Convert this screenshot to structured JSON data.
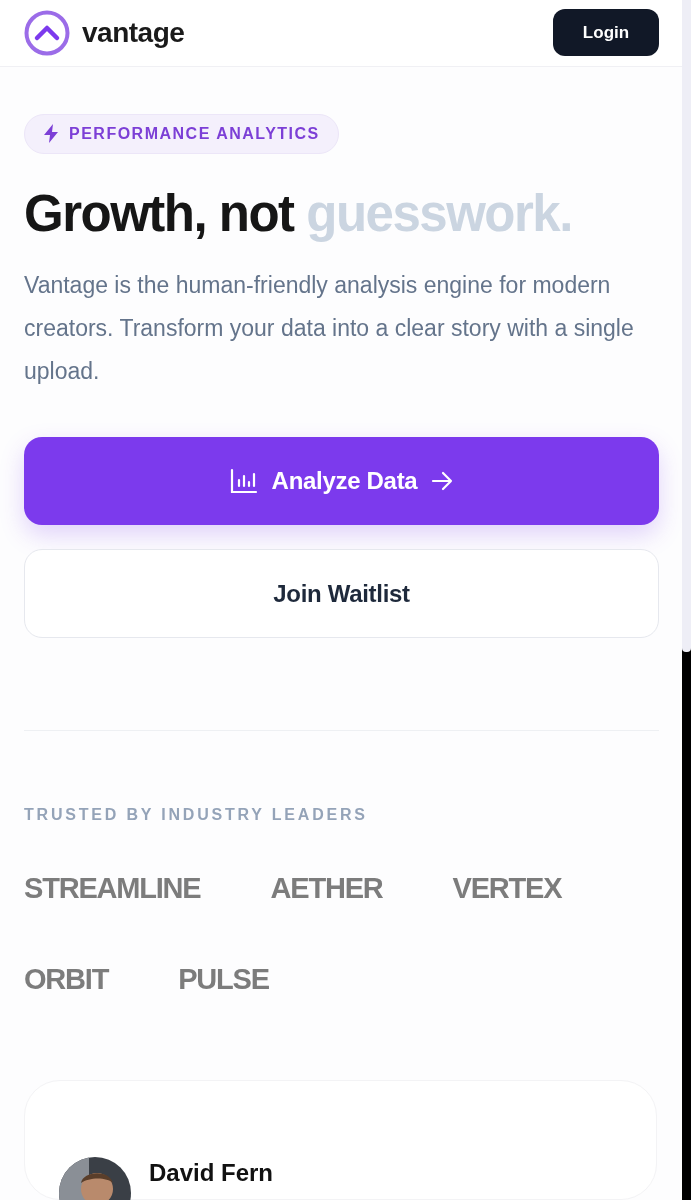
{
  "header": {
    "brand": "vantage",
    "login": "Login"
  },
  "badge": {
    "label": "PERFORMANCE ANALYTICS"
  },
  "headline": {
    "lead": "Growth, not",
    "accent": "guesswork."
  },
  "intro": "Vantage is the human-friendly analysis engine for modern creators. Transform your data into a clear story with a single upload.",
  "buttons": [
    {
      "kind": "primary",
      "label": "Analyze Data"
    },
    {
      "kind": "secondary",
      "label": "Join Waitlist"
    }
  ],
  "trusted": {
    "title": "TRUSTED BY INDUSTRY LEADERS",
    "logos": [
      "STREAMLINE",
      "AETHER",
      "VERTEX",
      "ORBIT",
      "PULSE"
    ]
  },
  "testimonial": {
    "kind": "picture",
    "name": "David Fern"
  }
}
